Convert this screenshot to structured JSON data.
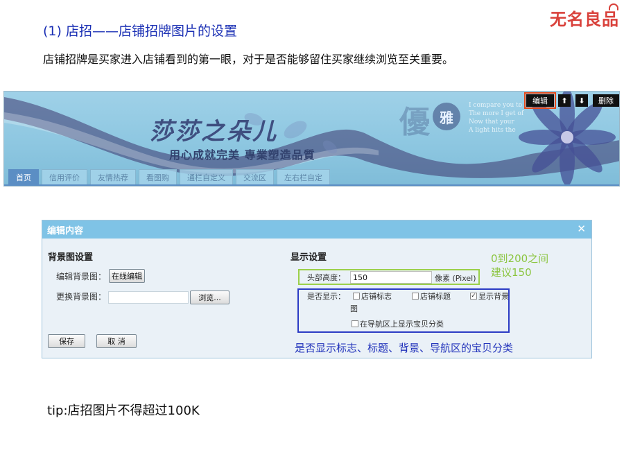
{
  "brand": {
    "logo_text": "无名良品"
  },
  "header": {
    "section_title": "(1) 店招——店铺招牌图片的设置",
    "intro": "店铺招牌是买家进入店铺看到的第一眼，对于是否能够留住买家继续浏览至关重要。"
  },
  "banner": {
    "shop_name": "莎莎之朵儿",
    "slogan": "用心成就完美 專業塑造品質",
    "elegant_char": "優",
    "elegant_circle_char": "雅",
    "poem_lines": [
      "I compare you to",
      "The more I get of",
      "Now that your",
      "A light hits the"
    ],
    "controls": {
      "edit": "编辑",
      "up": "⬆",
      "down": "⬇",
      "delete": "删除"
    },
    "nav_tabs": [
      "首页",
      "信用评价",
      "友情热荐",
      "看图购",
      "通栏自定义",
      "交流区",
      "左右栏自定"
    ]
  },
  "dialog": {
    "title": "编辑内容",
    "close": "✕",
    "bg_section": {
      "heading": "背景图设置",
      "edit_bg_label": "编辑背景图：",
      "edit_online_button": "在线编辑",
      "change_bg_label": "更换背景图：",
      "browse_button": "浏览..."
    },
    "display_section": {
      "heading": "显示设置",
      "height_label": "头部高度：",
      "height_value": "150",
      "height_unit": "像素 (Pixel)",
      "show_label": "是否显示：",
      "checkboxes": [
        {
          "label": "店铺标志",
          "checked": false
        },
        {
          "label": "店铺标题",
          "checked": false
        },
        {
          "label": "显示背景",
          "checked": true
        }
      ],
      "wrap_char": "图",
      "nav_checkbox": {
        "label": "在导航区上显示宝贝分类",
        "checked": false
      }
    },
    "buttons": {
      "save": "保存",
      "cancel": "取 消"
    },
    "annotations": {
      "range_line1": "0到200之间",
      "range_line2": "建议150",
      "show_note": "是否显示标志、标题、背景、导航区的宝贝分类"
    }
  },
  "tip": "tip:店招图片不得超过100K",
  "colors": {
    "title_blue": "#1a2fb4",
    "brand_red": "#d9413b",
    "note_green": "#8bc53f",
    "highlight_orange": "#e64a19"
  }
}
